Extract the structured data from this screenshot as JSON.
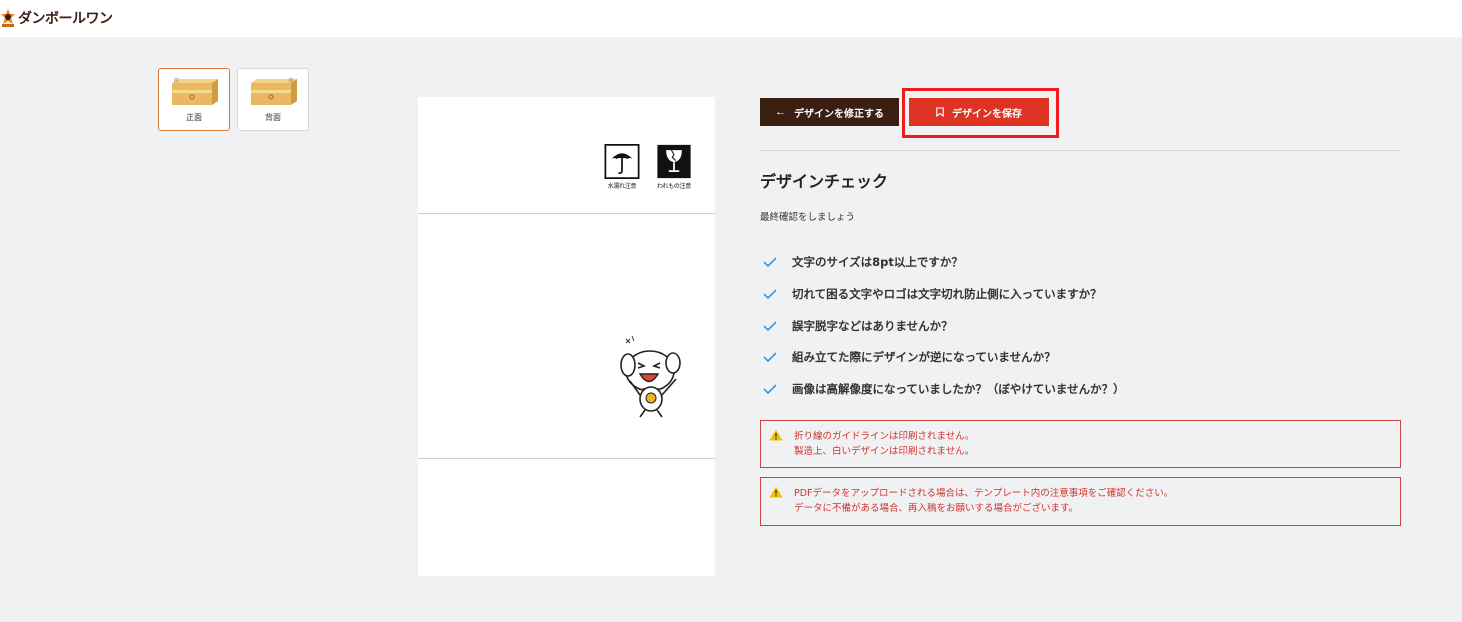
{
  "header": {
    "logo_text": "ダンボールワン"
  },
  "thumbnails": [
    {
      "label": "正面",
      "active": true
    },
    {
      "label": "背面",
      "active": false
    }
  ],
  "preview": {
    "care_marks": [
      {
        "label": "水濡れ注意",
        "icon": "umbrella-icon"
      },
      {
        "label": "われもの注意",
        "icon": "fragile-glass-icon"
      }
    ]
  },
  "actions": {
    "edit_label": "デザインを修正する",
    "save_label": "デザインを保存"
  },
  "check": {
    "title": "デザインチェック",
    "subtitle": "最終確認をしましょう",
    "items": [
      "文字のサイズは8pt以上ですか？",
      "切れて困る文字やロゴは文字切れ防止側に入っていますか？",
      "誤字脱字などはありませんか？",
      "組み立てた際にデザインが逆になっていませんか？",
      "画像は高解像度になっていましたか？（ぼやけていませんか？）"
    ]
  },
  "warnings": [
    {
      "lines": [
        "折り線のガイドラインは印刷されません。",
        "製造上、白いデザインは印刷されません。"
      ]
    },
    {
      "lines": [
        "PDFデータをアップロードされる場合は、テンプレート内の注意事項をご確認ください。",
        "データに不備がある場合、再入稿をお願いする場合がございます。"
      ]
    }
  ],
  "colors": {
    "brand_dark": "#3a1f12",
    "save_red": "#dd3322",
    "highlight_red": "#ee1c1c",
    "check_blue": "#2a8fd0",
    "warn_red": "#d0342c"
  }
}
